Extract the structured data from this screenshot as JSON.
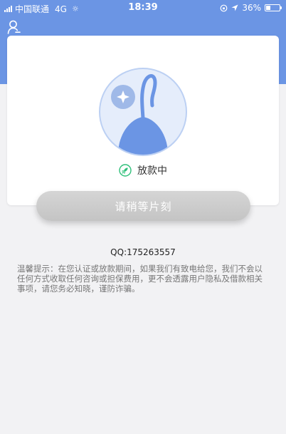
{
  "status_bar": {
    "carrier": "中国联通",
    "network": "4G",
    "time": "18:39",
    "battery": "36%",
    "battery_level": 0.36
  },
  "loan": {
    "status_text": "放款中",
    "button_label": "请稍等片刻"
  },
  "contact": {
    "qq": "QQ:175263557"
  },
  "tips": {
    "text": "温馨提示：在您认证或放款期间，如果我们有致电给您，我们不会以任何方式收取任何咨询或担保费用，更不会透露用户隐私及借款相关事项，请您务必知晓，谨防诈骗。"
  },
  "colors": {
    "brand_blue": "#6b95e4",
    "status_green": "#2fc07a"
  }
}
